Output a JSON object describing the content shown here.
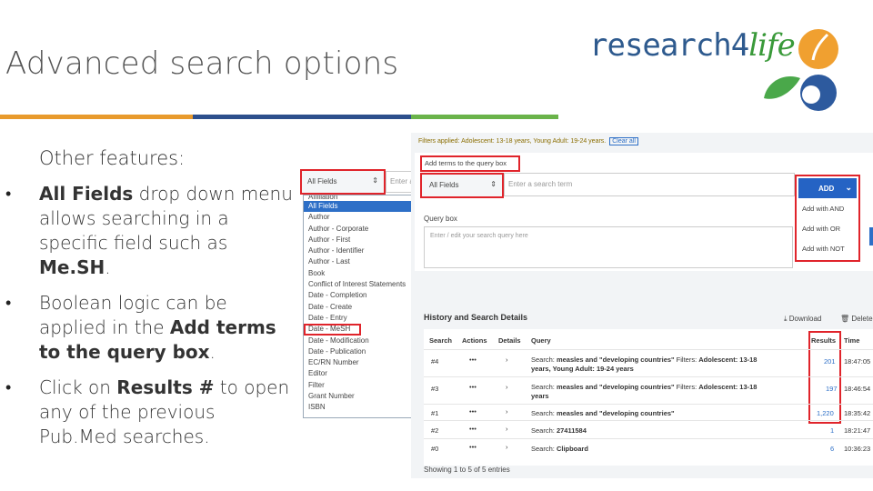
{
  "slide": {
    "title": "Advanced search options",
    "intro": "Other features:",
    "bullet1_bold": "All Fields",
    "bullet1_text": " drop down menu allows searching in a specific field such as ",
    "bullet1_bold2": "Me.SH",
    "bullet1_end": ".",
    "bullet2_text": "Boolean logic can be applied in the ",
    "bullet2_bold": "Add terms to the query box",
    "bullet2_end": ".",
    "bullet3_text": "Click on ",
    "bullet3_bold": "Results #",
    "bullet3_end": " to open any of the previous Pub.Med searches.",
    "bullet_char": "•"
  },
  "logo": {
    "part1": "research4",
    "part2": "life"
  },
  "colors": {
    "rule1": "#e89a2c",
    "rule2": "#2d4f8c",
    "rule3": "#6ab34a",
    "highlight": "#e0242b",
    "link": "#2d6fc7"
  },
  "left_dropdown": {
    "select_value": "All Fields",
    "input_placeholder": "Enter a s",
    "items": [
      "Affiliation",
      "All Fields",
      "Author",
      "Author - Corporate",
      "Author - First",
      "Author - Identifier",
      "Author - Last",
      "Book",
      "Conflict of Interest Statements",
      "Date - Completion",
      "Date - Create",
      "Date - Entry",
      "Date - MeSH",
      "Date - Modification",
      "Date - Publication",
      "EC/RN Number",
      "Editor",
      "Filter",
      "Grant Number",
      "ISBN"
    ],
    "selected_index": 1,
    "highlighted_index": 12
  },
  "pubmed": {
    "filters_label": "Filters applied: Adolescent: 13-18 years, Young Adult: 19-24 years.",
    "clear_all": "Clear all",
    "add_terms_label": "Add terms to the query box",
    "field_select": "All Fields",
    "search_placeholder": "Enter a search term",
    "add_button": "ADD",
    "add_options": [
      "Add with AND",
      "Add with OR",
      "Add with NOT"
    ],
    "query_box_label": "Query box",
    "query_placeholder": "Enter / edit your search query here",
    "history_title": "History and Search Details",
    "download": "Download",
    "delete": "Delete",
    "columns": [
      "Search",
      "Actions",
      "Details",
      "Query",
      "Results",
      "Time"
    ],
    "rows": [
      {
        "num": "#4",
        "q1": "Search: ",
        "q2": "measles and \"developing countries\"",
        "q3": " Filters: ",
        "q4": "Adolescent: 13-18 years, Young Adult: 19-24 years",
        "results": "201",
        "time": "18:47:05"
      },
      {
        "num": "#3",
        "q1": "Search: ",
        "q2": "measles and \"developing countries\"",
        "q3": " Filters: ",
        "q4": "Adolescent: 13-18 years",
        "results": "197",
        "time": "18:46:54"
      },
      {
        "num": "#1",
        "q1": "Search: ",
        "q2": "measles and \"developing countries\"",
        "q3": "",
        "q4": "",
        "results": "1,220",
        "time": "18:35:42"
      },
      {
        "num": "#2",
        "q1": "Search: ",
        "q2": "27411584",
        "q3": "",
        "q4": "",
        "results": "1",
        "time": "18:21:47"
      },
      {
        "num": "#0",
        "q1": "Search: ",
        "q2": "Clipboard",
        "q3": "",
        "q4": "",
        "results": "6",
        "time": "10:36:23"
      }
    ],
    "footer": "Showing 1 to 5 of 5 entries"
  }
}
